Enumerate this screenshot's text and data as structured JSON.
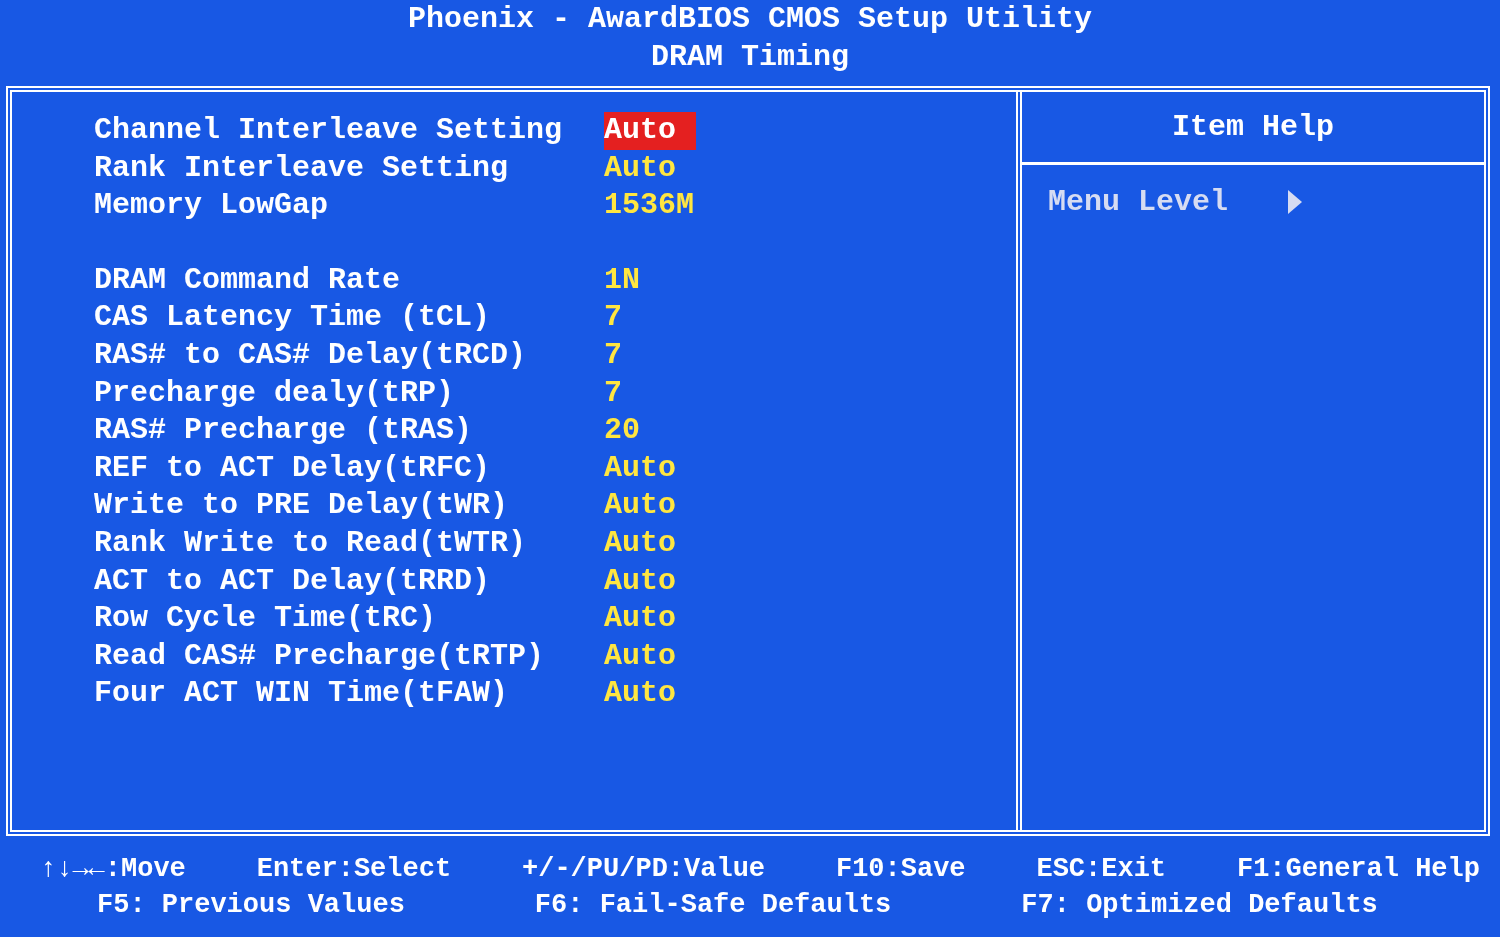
{
  "header": {
    "title": "Phoenix - AwardBIOS CMOS Setup Utility",
    "subtitle": "DRAM Timing"
  },
  "groups": [
    [
      {
        "label": "Channel Interleave Setting",
        "value": "Auto",
        "selected": true
      },
      {
        "label": "Rank Interleave Setting",
        "value": "Auto",
        "selected": false
      },
      {
        "label": "Memory LowGap",
        "value": "1536M",
        "selected": false
      }
    ],
    [
      {
        "label": "DRAM Command Rate",
        "value": "1N",
        "selected": false
      },
      {
        "label": "CAS Latency Time (tCL)",
        "value": "7",
        "selected": false
      },
      {
        "label": "RAS# to CAS# Delay(tRCD)",
        "value": "7",
        "selected": false
      },
      {
        "label": "Precharge dealy(tRP)",
        "value": "7",
        "selected": false
      },
      {
        "label": "RAS# Precharge (tRAS)",
        "value": "20",
        "selected": false
      },
      {
        "label": "REF to ACT Delay(tRFC)",
        "value": "Auto",
        "selected": false
      },
      {
        "label": "Write to PRE Delay(tWR)",
        "value": "Auto",
        "selected": false
      },
      {
        "label": "Rank Write to Read(tWTR)",
        "value": "Auto",
        "selected": false
      },
      {
        "label": "ACT to ACT Delay(tRRD)",
        "value": "Auto",
        "selected": false
      },
      {
        "label": "Row Cycle Time(tRC)",
        "value": "Auto",
        "selected": false
      },
      {
        "label": "Read CAS# Precharge(tRTP)",
        "value": "Auto",
        "selected": false
      },
      {
        "label": "Four ACT WIN Time(tFAW)",
        "value": "Auto",
        "selected": false
      }
    ]
  ],
  "help": {
    "title": "Item Help",
    "menu_level": "Menu Level"
  },
  "footer": [
    [
      "↑↓→←:Move",
      "Enter:Select",
      "+/-/PU/PD:Value",
      "F10:Save",
      "ESC:Exit",
      "F1:General Help"
    ],
    [
      "F5: Previous Values",
      "F6: Fail-Safe Defaults",
      "F7: Optimized Defaults"
    ]
  ]
}
